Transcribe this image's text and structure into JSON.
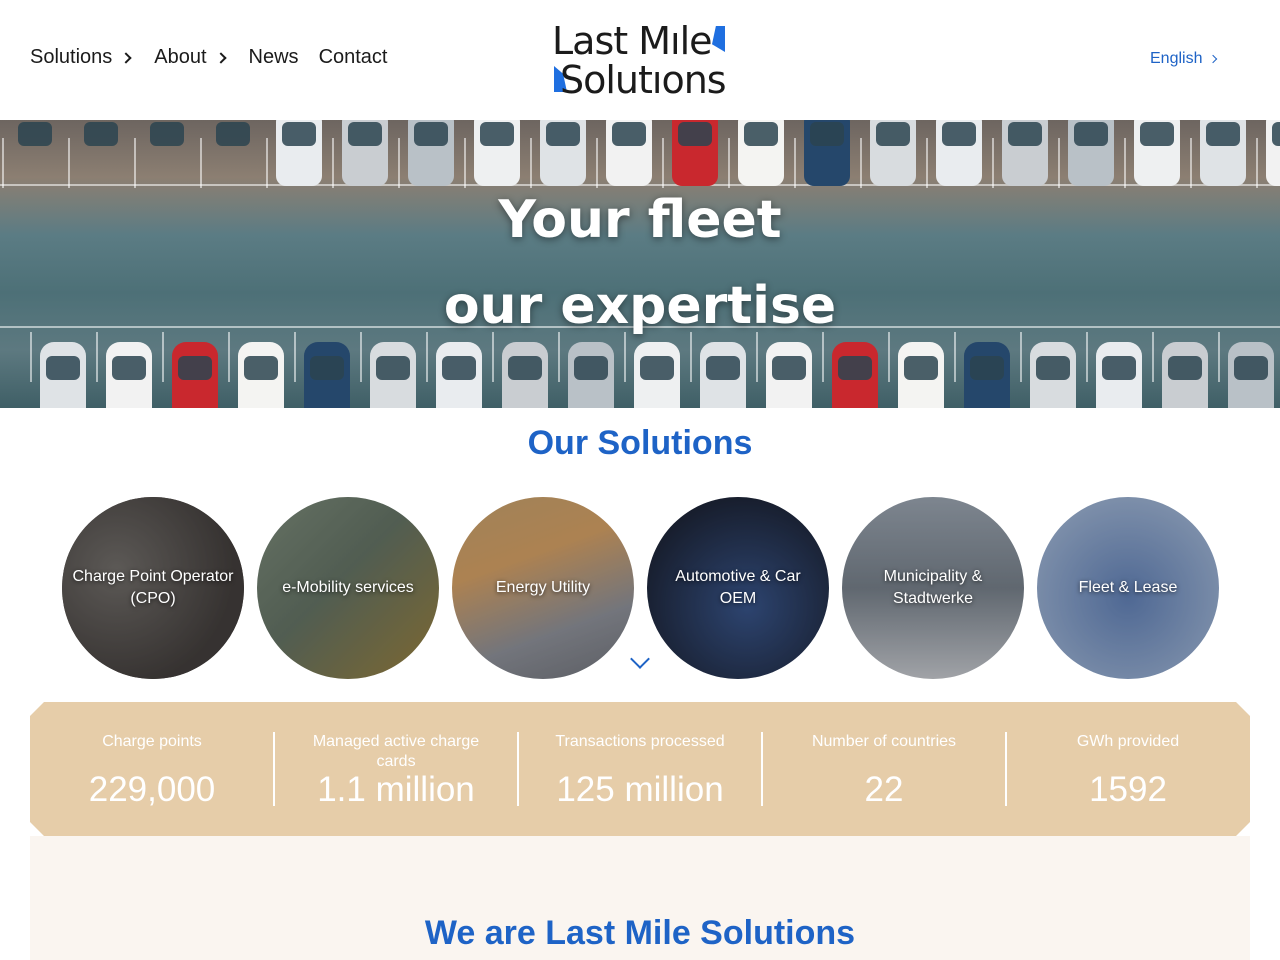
{
  "nav": {
    "items": [
      {
        "label": "Solutions",
        "has_chevron": true
      },
      {
        "label": "About",
        "has_chevron": true
      },
      {
        "label": "News",
        "has_chevron": false
      },
      {
        "label": "Contact",
        "has_chevron": false
      }
    ]
  },
  "logo": {
    "line1": "Last Mıle",
    "line2": "Solutıons",
    "accent": "#1f6fe0"
  },
  "language": {
    "label": "English"
  },
  "hero": {
    "line1": "Your  fleet",
    "line2": "our expertise"
  },
  "solutions": {
    "title": "Our Solutions",
    "items": [
      {
        "label": "Charge Point Operator (CPO)"
      },
      {
        "label": "e-Mobility services"
      },
      {
        "label": "Energy Utility"
      },
      {
        "label": "Automotive & Car OEM"
      },
      {
        "label": "Municipality & Stadtwerke"
      },
      {
        "label": "Fleet & Lease"
      }
    ]
  },
  "stats": [
    {
      "label": "Charge points",
      "value": "229,000"
    },
    {
      "label": "Managed active charge cards",
      "value": "1.1 million"
    },
    {
      "label": "Transactions processed",
      "value": "125 million"
    },
    {
      "label": "Number of countries",
      "value": "22"
    },
    {
      "label": "GWh provided",
      "value": "1592"
    }
  ],
  "about": {
    "title": "We are Last Mile Solutions"
  },
  "colors": {
    "brand_blue": "#1e63c6",
    "stats_bg": "#e6cda9",
    "section_bg": "#faf5f0"
  }
}
